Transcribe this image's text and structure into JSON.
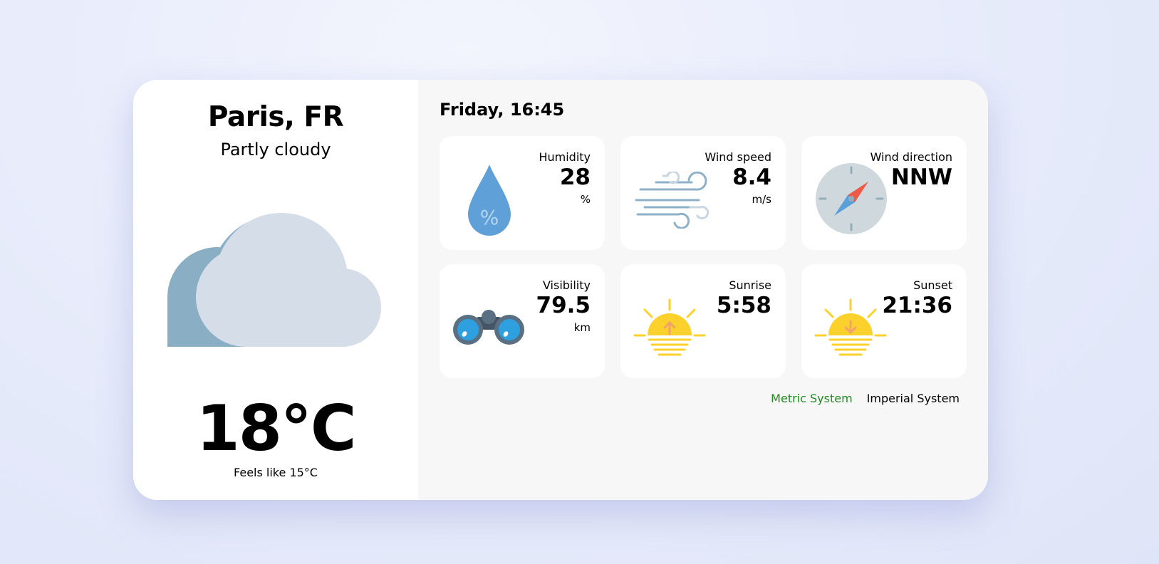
{
  "location": {
    "city": "Paris, FR",
    "condition": "Partly cloudy",
    "condition_icon": "partly-cloudy-icon"
  },
  "temperature": {
    "value": "18°C",
    "feels_like": "Feels like 15°C"
  },
  "datetime": "Friday, 16:45",
  "metrics": {
    "humidity": {
      "label": "Humidity",
      "value": "28",
      "unit": "%",
      "icon": "humidity-drop-icon"
    },
    "wind_speed": {
      "label": "Wind speed",
      "value": "8.4",
      "unit": "m/s",
      "icon": "wind-icon"
    },
    "wind_direction": {
      "label": "Wind direction",
      "value": "NNW",
      "icon": "compass-icon"
    },
    "visibility": {
      "label": "Visibility",
      "value": "79.5",
      "unit": "km",
      "icon": "binoculars-icon"
    },
    "sunrise": {
      "label": "Sunrise",
      "value": "5:58",
      "icon": "sunrise-icon"
    },
    "sunset": {
      "label": "Sunset",
      "value": "21:36",
      "icon": "sunset-icon"
    }
  },
  "unit_switch": {
    "metric_label": "Metric System",
    "imperial_label": "Imperial System",
    "active": "metric"
  },
  "colors": {
    "active_unit": "#1f8a1f",
    "cloud_back": "#8aafc4",
    "cloud_front": "#d5dde9",
    "sun": "#fdd12b"
  }
}
